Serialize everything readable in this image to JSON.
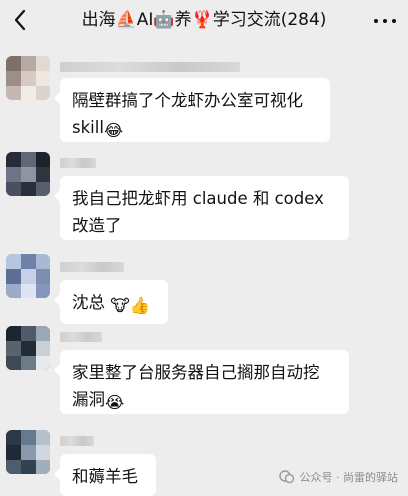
{
  "header": {
    "title": "出海⛵AI🤖养🦞学习交流(284)",
    "back_icon": "chevron-left-icon",
    "more_icon": "more-dots-icon"
  },
  "messages": [
    {
      "sender": "",
      "text_line1": "隔壁群搞了个龙虾办公室可视化",
      "text_line2": "skill",
      "emoji": "😂"
    },
    {
      "sender": "",
      "text_line1": "我自己把龙虾用 claude 和 codex",
      "text_line2": "改造了",
      "emoji": ""
    },
    {
      "sender": "",
      "text_line1": "沈总",
      "text_line2": "",
      "emoji": "🐮👍"
    },
    {
      "sender": "",
      "text_line1": "家里整了台服务器自己搁那自动挖",
      "text_line2": "漏洞",
      "emoji": "😭"
    },
    {
      "sender": "",
      "text_line1": "和薅羊毛",
      "text_line2": "",
      "emoji": ""
    }
  ],
  "watermark": {
    "text": "公众号 · 尚雷的驿站",
    "icon": "wechat-official-account-icon"
  },
  "colors": {
    "background": "#ededed",
    "bubble": "#ffffff",
    "text": "#111111"
  }
}
